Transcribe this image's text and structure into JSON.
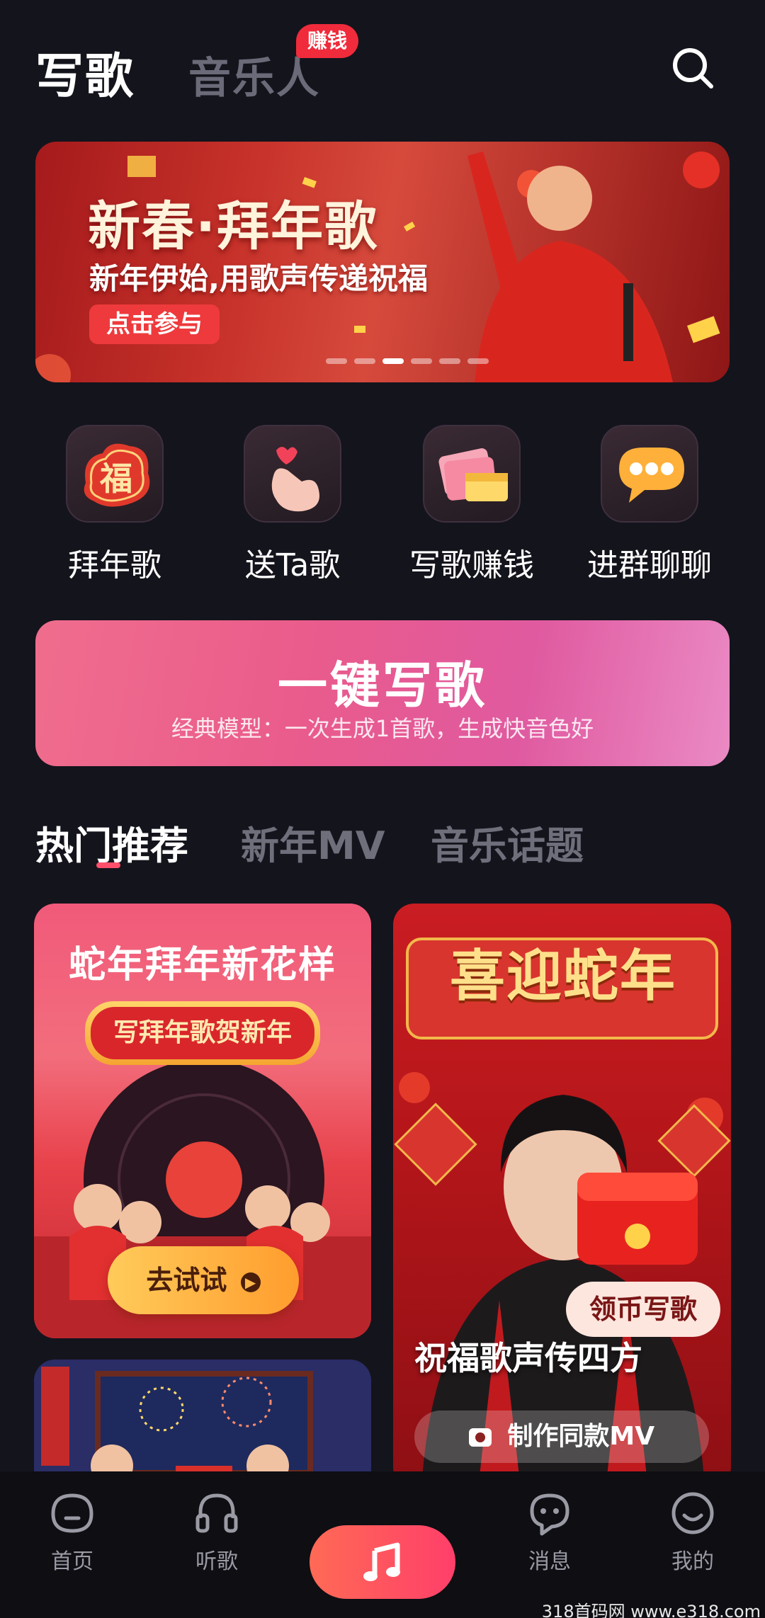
{
  "header": {
    "tab_write_song": "写歌",
    "tab_musician": "音乐人",
    "earn_badge": "赚钱"
  },
  "banner": {
    "title": "新春·拜年歌",
    "subtitle": "新年伊始,用歌声传递祝福",
    "cta": "点击参与",
    "slides": 6,
    "active_slide": 3
  },
  "quick_entries": [
    {
      "label": "拜年歌",
      "icon": "fu-blessing-icon"
    },
    {
      "label": "送Ta歌",
      "icon": "finger-heart-icon"
    },
    {
      "label": "写歌赚钱",
      "icon": "money-stack-icon"
    },
    {
      "label": "进群聊聊",
      "icon": "chat-bubble-icon"
    }
  ],
  "one_key": {
    "title": "一键写歌",
    "subtitle": "经典模型：一次生成1首歌，生成快音色好"
  },
  "section_tabs": [
    "热门推荐",
    "新年MV",
    "音乐话题"
  ],
  "cards": {
    "card_a": {
      "title": "蛇年拜年新花样",
      "scroll_text": "写拜年歌贺新年",
      "button": "去试试"
    },
    "card_b": {
      "headline": "喜迎蛇年",
      "coin_button": "领币写歌",
      "caption": "祝福歌声传四方",
      "make_button": "制作同款MV"
    }
  },
  "bottom_nav": [
    {
      "label": "首页"
    },
    {
      "label": "听歌"
    },
    {
      "label": ""
    },
    {
      "label": "消息"
    },
    {
      "label": "我的"
    }
  ],
  "watermark": "318首码网 www.e318.com",
  "colors": {
    "background": "#14141c",
    "accent": "#ff4f6a",
    "badge": "#ef2b3c"
  }
}
